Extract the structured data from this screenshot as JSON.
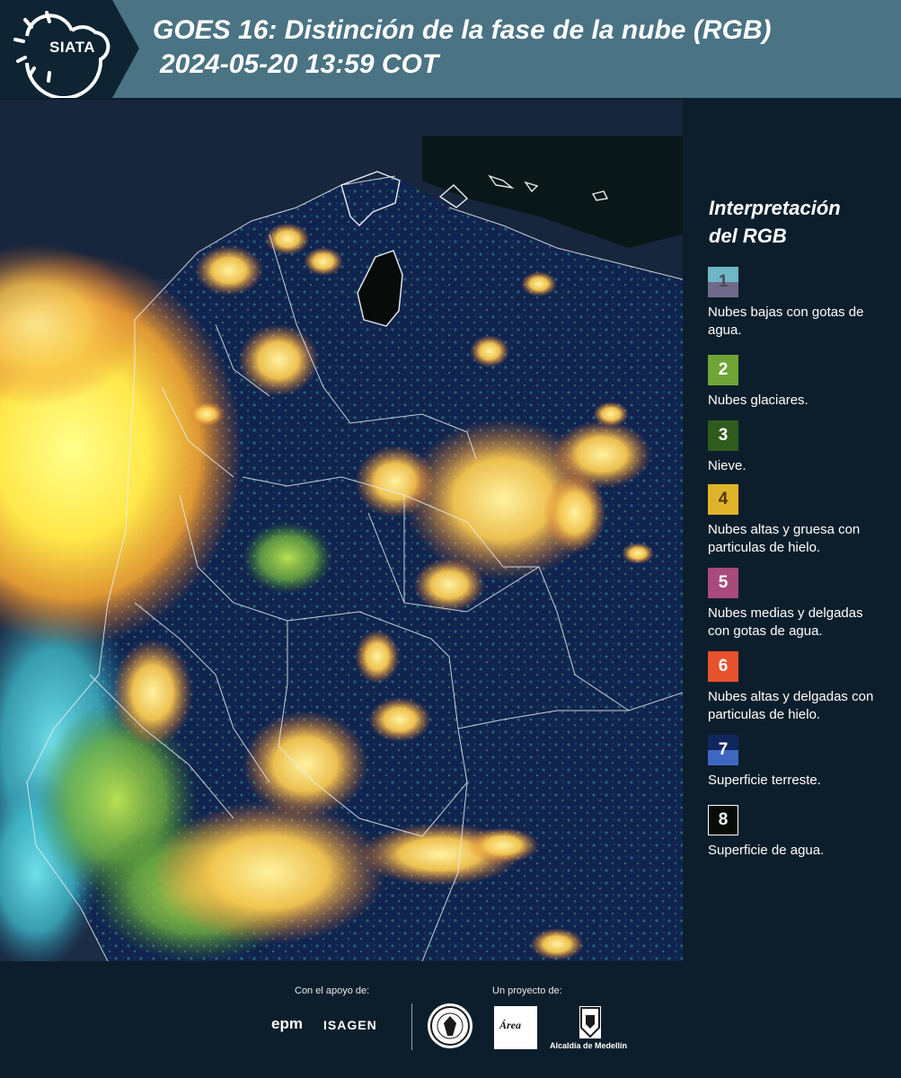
{
  "header": {
    "logo_text": "SIATA",
    "title": "GOES 16: Distinción de la fase de la nube (RGB)",
    "subtitle": "2024-05-20 13:59 COT"
  },
  "legend": {
    "title_line1": "Interpretación",
    "title_line2": "del RGB",
    "items": [
      {
        "number": "1",
        "label": "Nubes bajas con gotas de agua.",
        "color_top": "#6fb7c6",
        "color_bottom": "#6f6a8a",
        "num_color": "#4a4a5a"
      },
      {
        "number": "2",
        "label": "Nubes glaciares.",
        "color": "#6fa436",
        "num_color": "#ffffff"
      },
      {
        "number": "3",
        "label": "Nieve.",
        "color": "#2f5b1c",
        "num_color": "#ffffff"
      },
      {
        "number": "4",
        "label": "Nubes altas y gruesa con particulas de hielo.",
        "color": "#e0b42a",
        "num_color": "#4a3a10"
      },
      {
        "number": "5",
        "label": "Nubes medias y delgadas con gotas de agua.",
        "color": "#a84a7c",
        "num_color": "#ffffff"
      },
      {
        "number": "6",
        "label": "Nubes altas y delgadas con particulas de hielo.",
        "color": "#e8522c",
        "num_color": "#ffffff"
      },
      {
        "number": "7",
        "label": "Superficie terreste.",
        "color_top": "#10265e",
        "color_bottom": "#3e68c0",
        "num_color": "#ffffff"
      },
      {
        "number": "8",
        "label": "Superficie de agua.",
        "color": "#070c08",
        "num_color": "#ffffff"
      }
    ]
  },
  "footer": {
    "support_label": "Con el apoyo de:",
    "project_label": "Un proyecto de:",
    "epm": "epm",
    "isagen": "ISAGEN",
    "area_text": "Área",
    "alcaldia": "Alcaldía de Medellín"
  },
  "colors": {
    "header_bg": "#4a7383",
    "panel_bg": "#0c1e2b",
    "ocean": "#1a2d45",
    "land": "#0f2550"
  }
}
